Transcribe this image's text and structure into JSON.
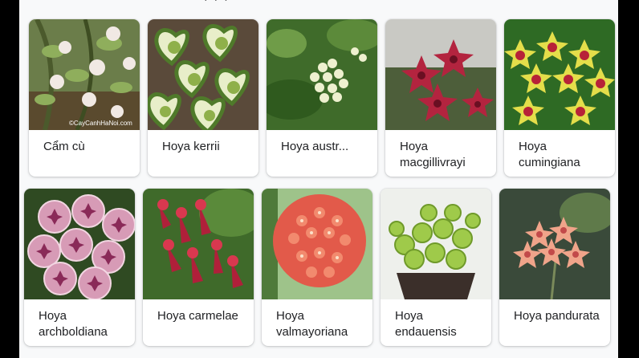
{
  "header": {
    "cut_text": "· · ·"
  },
  "cards": [
    {
      "label": "Cẩm cù",
      "image": "hoya-carnosa-vine-photo",
      "watermark": "©CayCanhHaNoi.com"
    },
    {
      "label": "Hoya kerrii",
      "image": "heart-shaped-variegated-leaves-photo"
    },
    {
      "label": "Hoya austr...",
      "image": "white-flower-cluster-photo"
    },
    {
      "label": "Hoya macgillivrayi",
      "image": "red-star-flowers-photo"
    },
    {
      "label": "Hoya cumingiana",
      "image": "yellow-red-star-flowers-photo"
    },
    {
      "label": "Hoya archboldiana",
      "image": "pink-cup-flowers-photo"
    },
    {
      "label": "Hoya carmelae",
      "image": "red-bell-flowers-photo"
    },
    {
      "label": "Hoya valmayoriana",
      "image": "coral-flower-ball-photo"
    },
    {
      "label": "Hoya endauensis",
      "image": "succulent-round-leaves-pot-photo"
    },
    {
      "label": "Hoya pandurata",
      "image": "peach-star-flowers-photo"
    }
  ],
  "colors": {
    "panel": "#f8f9fa",
    "card": "#ffffff",
    "text": "#202124"
  }
}
